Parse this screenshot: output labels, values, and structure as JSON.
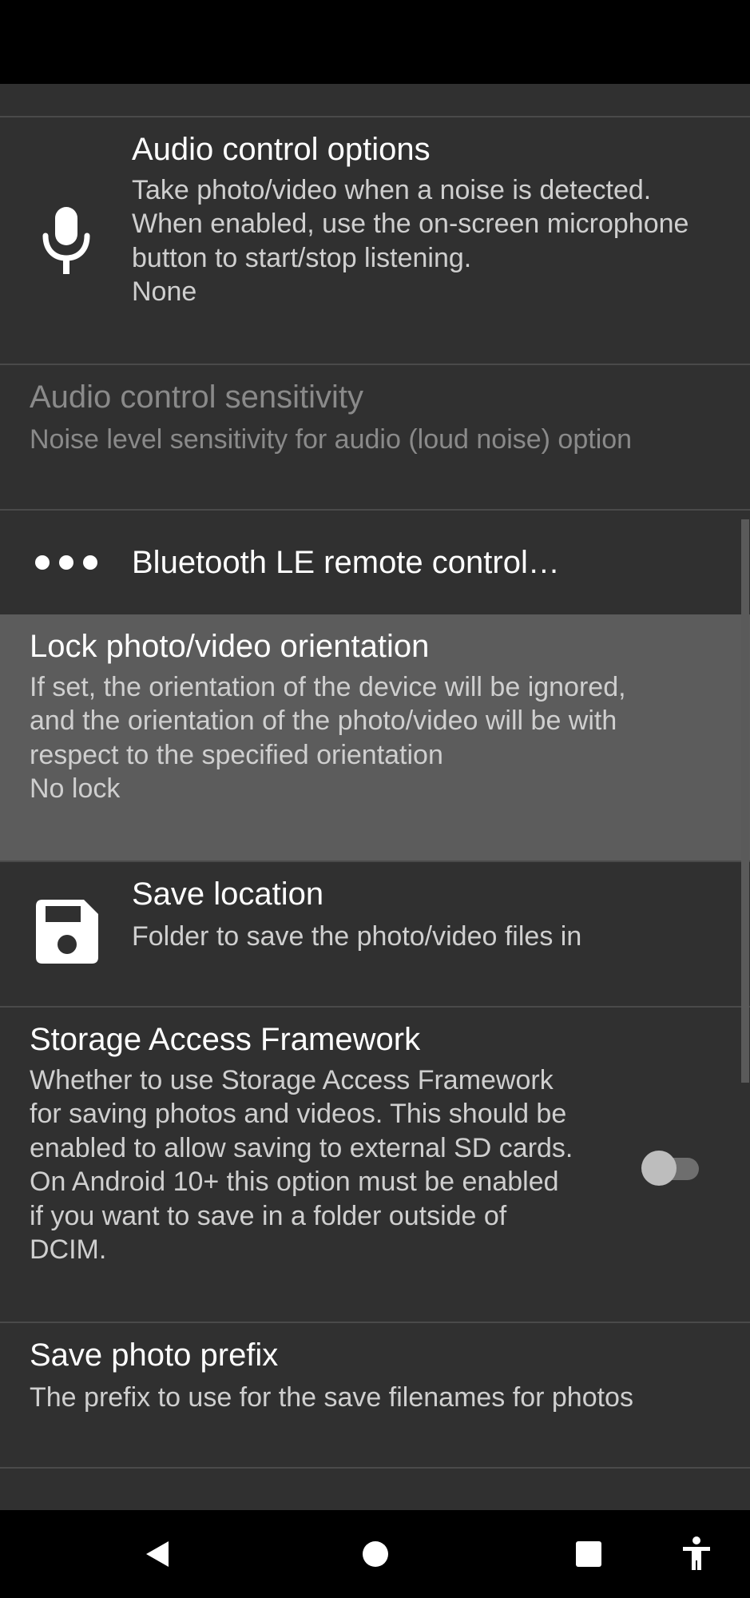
{
  "settings": [
    {
      "key": "audio_control_options",
      "title": "Audio control options",
      "summary_lines": [
        "Take photo/video when a noise is detected.",
        "When enabled, use the on-screen microphone",
        "button to start/stop listening.",
        "None"
      ],
      "icon": "microphone-icon",
      "enabled": true
    },
    {
      "key": "audio_control_sensitivity",
      "title": "Audio control sensitivity",
      "summary_lines": [
        "Noise level sensitivity for audio (loud noise) option"
      ],
      "enabled": false
    },
    {
      "key": "bluetooth_le_remote",
      "title": "Bluetooth LE remote control…",
      "icon": "more-horizontal-icon",
      "enabled": true
    },
    {
      "key": "lock_orientation",
      "title": "Lock photo/video orientation",
      "summary_lines": [
        "If set, the orientation of the device will be ignored,",
        "and the orientation of the photo/video will be with",
        "respect to the specified orientation",
        "No lock"
      ],
      "highlighted": true,
      "enabled": true
    },
    {
      "key": "save_location",
      "title": "Save location",
      "summary_lines": [
        "Folder to save the photo/video files in"
      ],
      "icon": "save-floppy-icon",
      "enabled": true
    },
    {
      "key": "storage_access_framework",
      "title": "Storage Access Framework",
      "summary_lines": [
        "Whether to use Storage Access Framework",
        "for saving photos and videos. This should be",
        "enabled to allow saving to external SD cards.",
        "On Android 10+ this option must be enabled",
        "if you want to save in a folder outside of",
        "DCIM."
      ],
      "toggle": false,
      "enabled": true
    },
    {
      "key": "save_photo_prefix",
      "title": "Save photo prefix",
      "summary_lines": [
        "The prefix to use for the save filenames for photos"
      ],
      "enabled": true
    }
  ],
  "nav_bar": {
    "back": "back-triangle-icon",
    "home": "home-circle-icon",
    "recents": "recents-square-icon",
    "accessibility": "accessibility-icon"
  },
  "colors": {
    "background": "#303030",
    "highlight": "#5c5c5c",
    "title_text": "#ffffff",
    "summary_text": "#cfcfcf",
    "disabled_text": "#8a8a8a",
    "bars": "#000000"
  }
}
